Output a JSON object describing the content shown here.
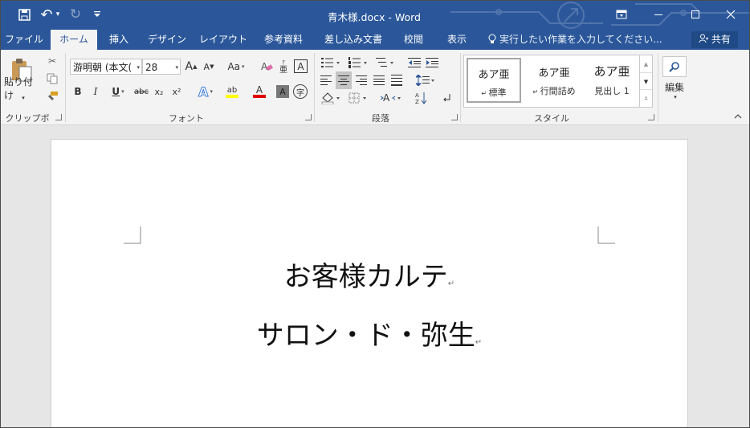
{
  "window": {
    "title": "青木様.docx - Word",
    "minimize": "—",
    "restore": "☐",
    "close": "✕",
    "ribbon_display": "▭"
  },
  "quick_access": {
    "save": "💾",
    "undo": "↶",
    "undo_dd": "▾",
    "redo": "↻",
    "customize": "⩡"
  },
  "tabs": [
    "ファイル",
    "ホーム",
    "挿入",
    "デザイン",
    "レイアウト",
    "参考資料",
    "差し込み文書",
    "校閲",
    "表示"
  ],
  "tell_me": "実行したい作業を入力してください...",
  "share": "共有",
  "clipboard": {
    "paste_label": "貼り付け",
    "group": "クリップボード"
  },
  "font": {
    "name": "游明朝 (本文(",
    "size": "28",
    "grow": "A",
    "shrink": "A",
    "case": "Aa",
    "bold": "B",
    "italic": "I",
    "underline": "U",
    "strike": "abc",
    "subscript": "x₂",
    "superscript": "x²",
    "text_effects": "A",
    "highlight": "ab",
    "font_color": "A",
    "char_shading": "A",
    "enclose": "字",
    "phonetic": "亜",
    "char_border": "A",
    "group": "フォント"
  },
  "paragraph": {
    "group": "段落"
  },
  "styles": {
    "items": [
      {
        "sample": "あア亜",
        "name": "標準"
      },
      {
        "sample": "あア亜",
        "name": "行間詰め"
      },
      {
        "sample": "あア亜",
        "name": "見出し 1"
      }
    ],
    "group": "スタイル"
  },
  "editing": {
    "label": "編集"
  },
  "document": {
    "line1": "お客様カルテ",
    "line2": "サロン・ド・弥生",
    "para_mark": "↵"
  },
  "colors": {
    "brand": "#2b579a",
    "highlight": "#ffff00",
    "font_color": "#e00000"
  }
}
